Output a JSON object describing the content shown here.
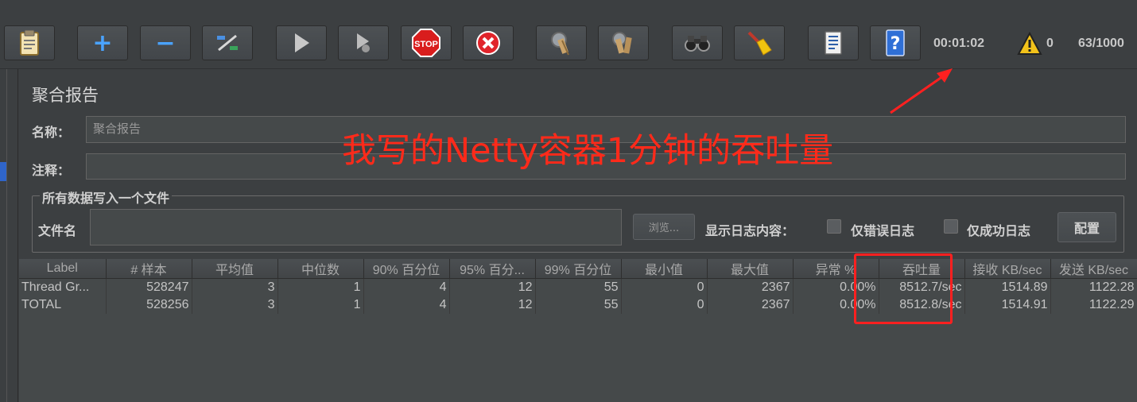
{
  "toolbar": {
    "buttons": [
      {
        "name": "templates-icon"
      },
      {
        "name": "expand-icon",
        "glyph": "+"
      },
      {
        "name": "collapse-icon",
        "glyph": "−"
      },
      {
        "name": "toggle-icon"
      },
      {
        "name": "start-icon"
      },
      {
        "name": "start-no-pause-icon"
      },
      {
        "name": "stop-icon",
        "glyph": "STOP"
      },
      {
        "name": "shutdown-icon"
      },
      {
        "name": "clear-icon"
      },
      {
        "name": "clear-all-icon"
      },
      {
        "name": "search-binoculars-icon"
      },
      {
        "name": "reset-search-broom-icon"
      },
      {
        "name": "function-helper-icon"
      },
      {
        "name": "help-icon",
        "glyph": "?"
      }
    ],
    "elapsed_time": "00:01:02",
    "warning_count": "0",
    "threads": "63/1000"
  },
  "panel": {
    "title": "聚合报告",
    "name_label": "名称：",
    "name_value": "聚合报告",
    "comment_label": "注释：",
    "comment_value": "",
    "file_group_title": "所有数据写入一个文件",
    "filename_label": "文件名",
    "filename_value": "",
    "browse_button": "浏览...",
    "log_content_label": "显示日志内容：",
    "errors_only_label": "仅错误日志",
    "success_only_label": "仅成功日志",
    "configure_button": "配置"
  },
  "table": {
    "headers": [
      "Label",
      "# 样本",
      "平均值",
      "中位数",
      "90% 百分位",
      "95% 百分...",
      "99% 百分位",
      "最小值",
      "最大值",
      "异常 %",
      "吞吐量",
      "接收 KB/sec",
      "发送 KB/sec"
    ],
    "rows": [
      [
        "Thread Gr...",
        "528247",
        "3",
        "1",
        "4",
        "12",
        "55",
        "0",
        "2367",
        "0.00%",
        "8512.7/sec",
        "1514.89",
        "1122.28"
      ],
      [
        "TOTAL",
        "528256",
        "3",
        "1",
        "4",
        "12",
        "55",
        "0",
        "2367",
        "0.00%",
        "8512.8/sec",
        "1514.91",
        "1122.29"
      ]
    ]
  },
  "annotation": {
    "text": "我写的Netty容器1分钟的吞吐量",
    "color": "#ff2a1a"
  }
}
